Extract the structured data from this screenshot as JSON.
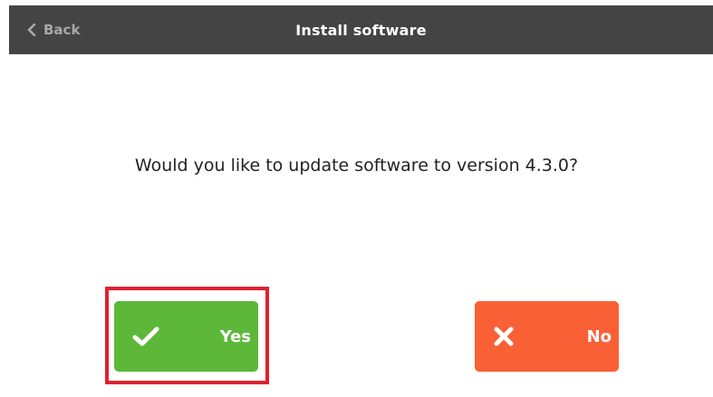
{
  "header": {
    "back_label": "Back",
    "title": "Install software"
  },
  "dialog": {
    "question": "Would you like to update software to version 4.3.0?"
  },
  "buttons": {
    "yes_label": "Yes",
    "no_label": "No",
    "yes_icon": "check-icon",
    "no_icon": "close-icon"
  },
  "colors": {
    "header_bg": "#444444",
    "yes_bg": "#5db83a",
    "no_bg": "#fa6035",
    "highlight_border": "#e0202f"
  }
}
